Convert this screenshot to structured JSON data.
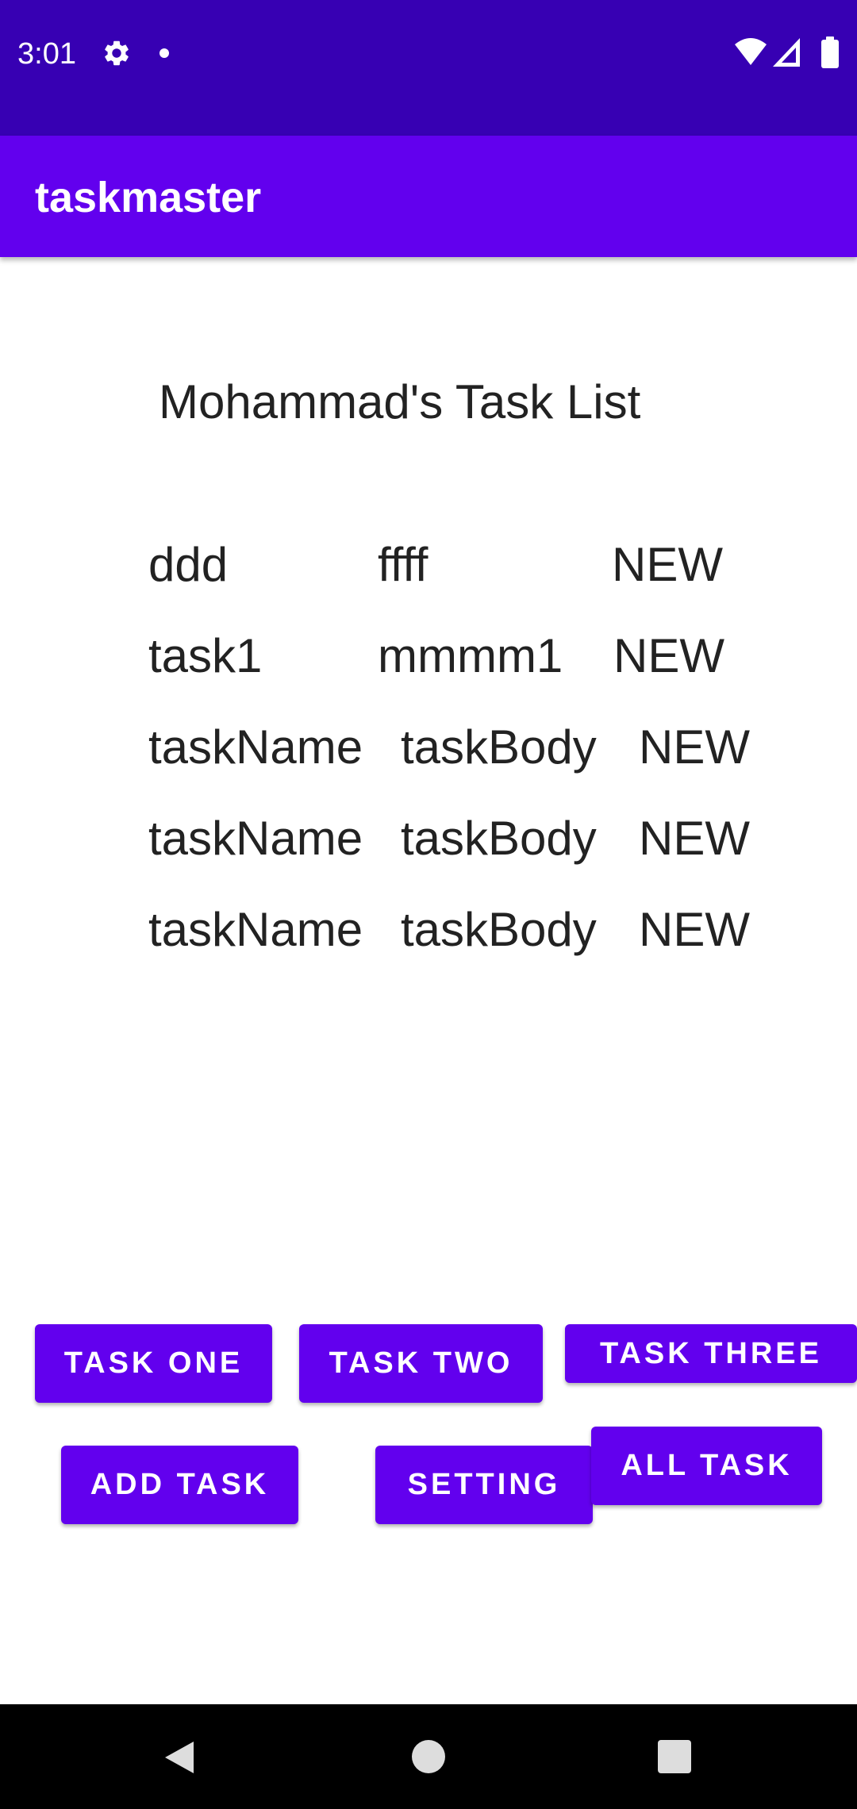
{
  "status_bar": {
    "time": "3:01",
    "icons": [
      "settings-gear-icon",
      "notification-dot-icon",
      "wifi-icon",
      "cellular-signal-icon",
      "battery-icon"
    ]
  },
  "app_bar": {
    "title": "taskmaster"
  },
  "main": {
    "heading": "Mohammad's Task List",
    "tasks": [
      {
        "title": "ddd",
        "body": "ffff",
        "state": "NEW"
      },
      {
        "title": "task1",
        "body": "mmmm1",
        "state": "NEW"
      },
      {
        "title": "taskName",
        "body": "taskBody",
        "state": "NEW"
      },
      {
        "title": "taskName",
        "body": "taskBody",
        "state": "NEW"
      },
      {
        "title": "taskName",
        "body": "taskBody",
        "state": "NEW"
      }
    ]
  },
  "buttons": {
    "task_one": "TASK ONE",
    "task_two": "TASK TWO",
    "task_three": "TASK THREE",
    "add_task": "ADD TASK",
    "setting": "SETTING",
    "all_task": "ALL TASK"
  },
  "nav_bar": {
    "icons": [
      "back-icon",
      "home-icon",
      "recents-icon"
    ]
  },
  "colors": {
    "status_bar": "#3700b3",
    "app_bar": "#6200ee",
    "button": "#6200ee",
    "text": "#222222",
    "nav_bar": "#000000"
  }
}
